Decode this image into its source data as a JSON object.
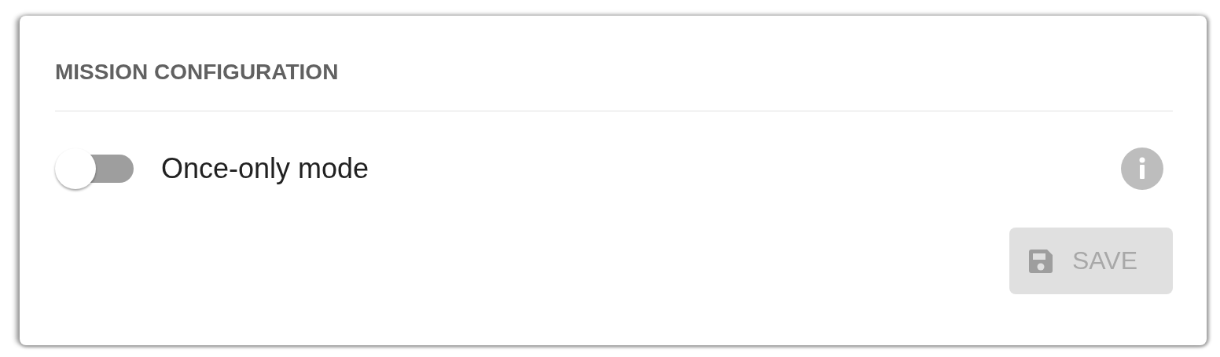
{
  "card": {
    "title": "MISSION CONFIGURATION"
  },
  "toggle": {
    "label": "Once-only mode",
    "on": false
  },
  "save_button": {
    "label": "SAVE",
    "disabled": true
  }
}
